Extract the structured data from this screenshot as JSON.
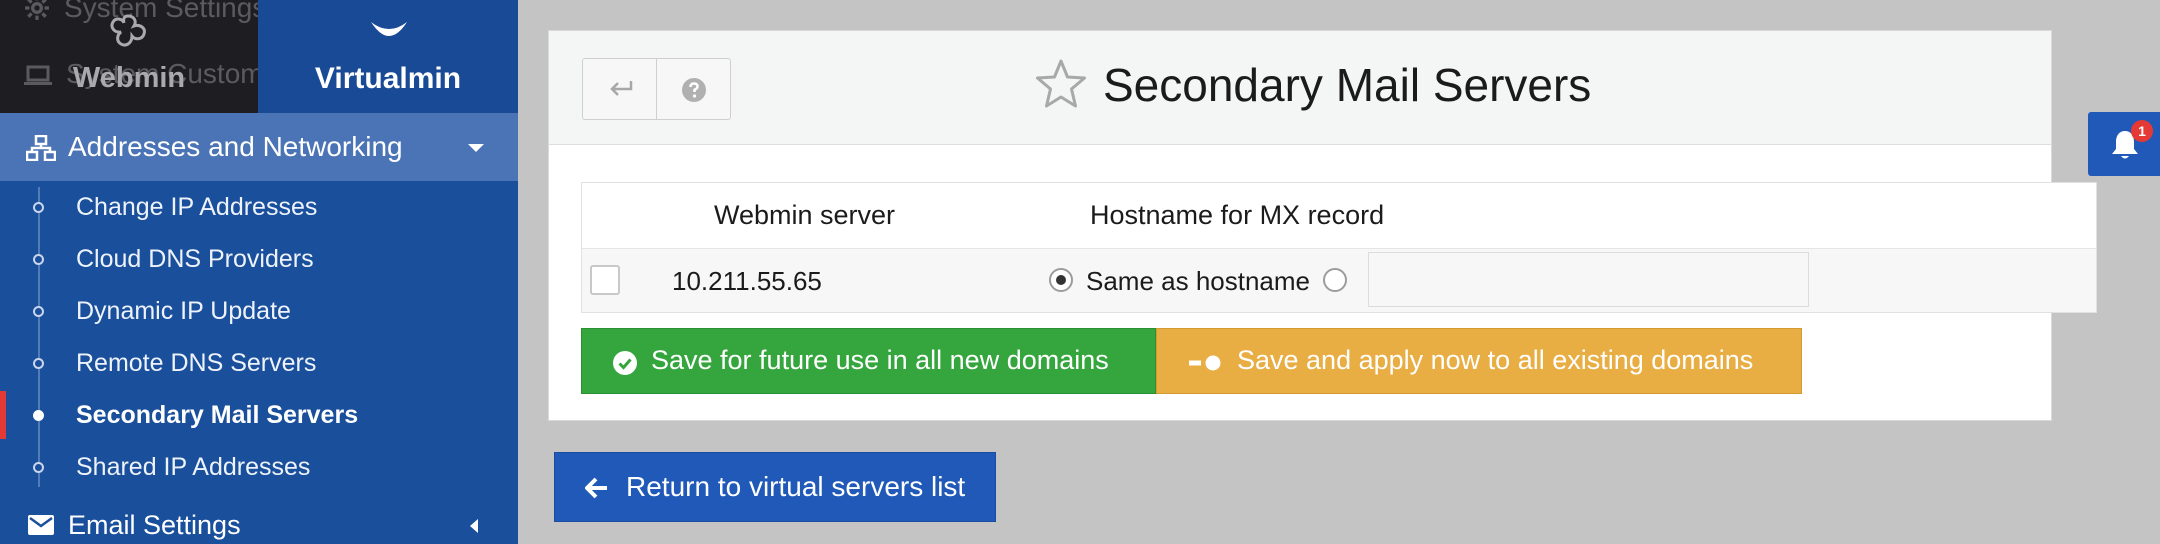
{
  "sidebar": {
    "ghost_rows": [
      "System Settings",
      "System Customization"
    ],
    "tabs": {
      "webmin": "Webmin",
      "virtualmin": "Virtualmin"
    },
    "section": {
      "label": "Addresses and Networking",
      "icon": "network-icon"
    },
    "items": [
      {
        "label": "Change IP Addresses",
        "active": false
      },
      {
        "label": "Cloud DNS Providers",
        "active": false
      },
      {
        "label": "Dynamic IP Update",
        "active": false
      },
      {
        "label": "Remote DNS Servers",
        "active": false
      },
      {
        "label": "Secondary Mail Servers",
        "active": true
      },
      {
        "label": "Shared IP Addresses",
        "active": false
      }
    ],
    "next_section": {
      "label": "Email Settings",
      "icon": "envelope-icon"
    }
  },
  "page": {
    "title": "Secondary Mail Servers"
  },
  "table": {
    "headers": {
      "server": "Webmin server",
      "hostname": "Hostname for MX record"
    },
    "row": {
      "ip": "10.211.55.65",
      "option_same": "Same as hostname",
      "custom_value": ""
    }
  },
  "actions": {
    "save_future": "Save for future use in all new domains",
    "save_apply": "Save and apply now to all existing domains",
    "return": "Return to virtual servers list"
  },
  "notifications": {
    "count": "1"
  },
  "colors": {
    "sidebar_bg": "#1a4f9c",
    "section_bg": "#4a74b6",
    "active_marker": "#e53935",
    "save_green": "#35a63e",
    "apply_orange": "#e8ad43",
    "return_blue": "#2059b8"
  }
}
